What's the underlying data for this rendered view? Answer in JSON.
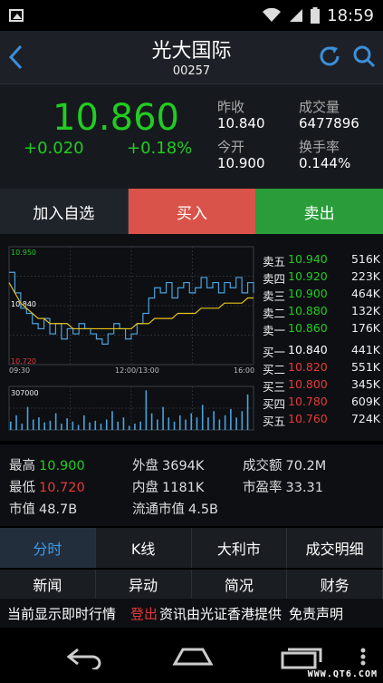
{
  "status_bar": {
    "time": "18:59"
  },
  "header": {
    "title": "光大国际",
    "code": "00257"
  },
  "quote": {
    "price": "10.860",
    "change": "+0.020",
    "change_pct": "+0.18%",
    "prev_close_label": "昨收",
    "prev_close": "10.840",
    "volume_label": "成交量",
    "volume": "6477896",
    "open_label": "今开",
    "open": "10.900",
    "turnover_label": "换手率",
    "turnover": "0.144%"
  },
  "actions": {
    "add": "加入自选",
    "buy": "买入",
    "sell": "卖出"
  },
  "chart_data": {
    "type": "line",
    "title": "",
    "xlabel": "",
    "ylabel": "",
    "y_ticks": [
      "10.950",
      "10.840",
      "10.720"
    ],
    "x_ticks": [
      "09:30",
      "12:00/13:00",
      "16:00"
    ],
    "ylim": [
      10.72,
      10.95
    ],
    "ref_price": 10.84,
    "price_series": [
      10.9,
      10.86,
      10.83,
      10.82,
      10.8,
      10.79,
      10.81,
      10.78,
      10.8,
      10.77,
      10.79,
      10.78,
      10.8,
      10.79,
      10.78,
      10.77,
      10.76,
      10.78,
      10.8,
      10.79,
      10.77,
      10.78,
      10.8,
      10.82,
      10.85,
      10.87,
      10.86,
      10.88,
      10.85,
      10.87,
      10.88,
      10.86,
      10.87,
      10.89,
      10.87,
      10.88,
      10.86,
      10.88,
      10.87,
      10.89,
      10.86,
      10.88,
      10.86
    ],
    "avg_series": [
      10.88,
      10.86,
      10.84,
      10.83,
      10.82,
      10.81,
      10.81,
      10.8,
      10.8,
      10.8,
      10.8,
      10.79,
      10.79,
      10.79,
      10.79,
      10.79,
      10.79,
      10.79,
      10.79,
      10.79,
      10.79,
      10.79,
      10.8,
      10.8,
      10.8,
      10.81,
      10.81,
      10.81,
      10.81,
      10.82,
      10.82,
      10.82,
      10.82,
      10.83,
      10.83,
      10.83,
      10.83,
      10.84,
      10.84,
      10.84,
      10.84,
      10.85,
      10.85
    ],
    "volume_ylabel": "307000",
    "volume_bars": [
      0.2,
      0.35,
      0.15,
      0.55,
      0.25,
      0.3,
      0.18,
      0.22,
      0.4,
      0.15,
      0.28,
      0.2,
      0.12,
      0.35,
      0.18,
      0.22,
      0.15,
      0.25,
      0.45,
      0.2,
      0.3,
      0.1,
      0.15,
      0.2,
      0.95,
      0.4,
      0.25,
      0.55,
      0.3,
      0.2,
      0.35,
      0.25,
      0.4,
      0.3,
      0.6,
      0.3,
      0.45,
      0.25,
      0.35,
      0.5,
      0.3,
      0.45,
      0.85
    ]
  },
  "orderbook": {
    "asks": [
      {
        "label": "卖五",
        "price": "10.940",
        "vol": "516K"
      },
      {
        "label": "卖四",
        "price": "10.920",
        "vol": "223K"
      },
      {
        "label": "卖三",
        "price": "10.900",
        "vol": "464K"
      },
      {
        "label": "卖二",
        "price": "10.880",
        "vol": "132K"
      },
      {
        "label": "卖一",
        "price": "10.860",
        "vol": "176K"
      }
    ],
    "bids": [
      {
        "label": "买一",
        "price": "10.840",
        "vol": "441K"
      },
      {
        "label": "买二",
        "price": "10.820",
        "vol": "551K"
      },
      {
        "label": "买三",
        "price": "10.800",
        "vol": "345K"
      },
      {
        "label": "买四",
        "price": "10.780",
        "vol": "609K"
      },
      {
        "label": "买五",
        "price": "10.760",
        "vol": "724K"
      }
    ]
  },
  "stats": {
    "high_label": "最高",
    "high": "10.900",
    "low_label": "最低",
    "low": "10.720",
    "mcap_label": "市值",
    "mcap": "48.7B",
    "outer_label": "外盘",
    "outer": "3694K",
    "inner_label": "内盘",
    "inner": "1181K",
    "float_label": "流通市值",
    "float": "4.5B",
    "amount_label": "成交额",
    "amount": "70.2M",
    "pe_label": "市盈率",
    "pe": "33.31"
  },
  "tabs_primary": [
    "分时",
    "K线",
    "大利市",
    "成交明细"
  ],
  "tabs_secondary": [
    "新闻",
    "异动",
    "简况",
    "财务"
  ],
  "ticker": {
    "text1": "当前显示即时行情",
    "login": "登出",
    "text2": "资讯由光证香港提供",
    "text3": "免责声明"
  },
  "watermark": "WWW.QT6.COM",
  "colors": {
    "up": "#e63a3a",
    "down": "#22cc22",
    "price_line": "#4aa3df",
    "avg_line": "#e8c21a",
    "accent": "#3a9be8"
  }
}
